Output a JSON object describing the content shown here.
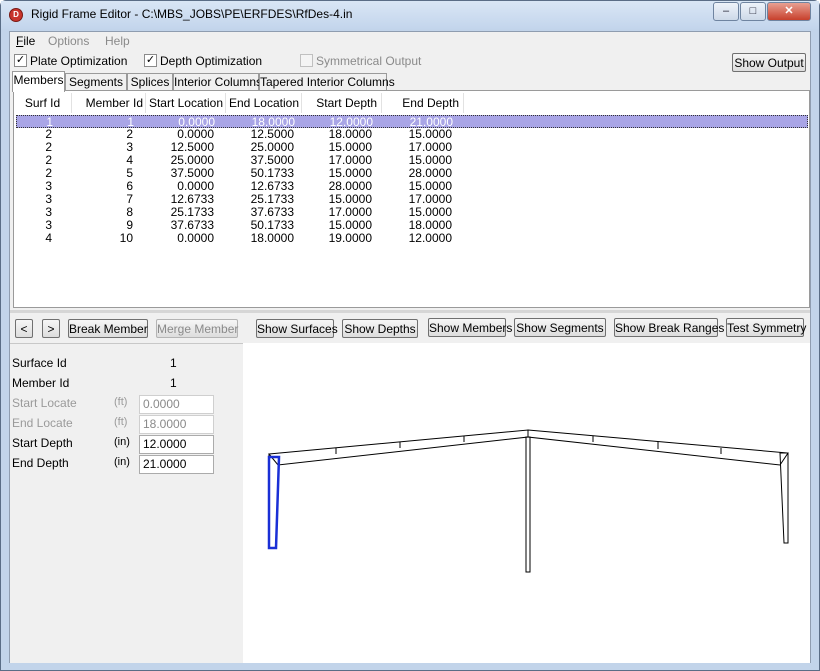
{
  "window": {
    "title": "Rigid Frame Editor - C:\\MBS_JOBS\\PE\\ERFDES\\RfDes-4.in",
    "icon": "app-logo-icon",
    "controls": [
      "minimize",
      "maximize",
      "close"
    ]
  },
  "menu": {
    "file": "File",
    "options": "Options",
    "help": "Help"
  },
  "toolbar": {
    "plate_optimization": {
      "label": "Plate Optimization",
      "checked": true
    },
    "depth_optimization": {
      "label": "Depth Optimization",
      "checked": true
    },
    "symmetrical_output": {
      "label": "Symmetrical Output",
      "checked": false
    },
    "show_output": "Show Output"
  },
  "tabs": [
    {
      "label": "Members",
      "active": true
    },
    {
      "label": "Segments",
      "active": false
    },
    {
      "label": "Splices",
      "active": false
    },
    {
      "label": "Interior Columns",
      "active": false
    },
    {
      "label": "Tapered Interior Columns",
      "active": false
    }
  ],
  "table": {
    "columns": [
      "Surf Id",
      "Member Id",
      "Start Location",
      "End Location",
      "Start Depth",
      "End Depth"
    ],
    "rows": [
      [
        "1",
        "1",
        "0.0000",
        "18.0000",
        "12.0000",
        "21.0000"
      ],
      [
        "2",
        "2",
        "0.0000",
        "12.5000",
        "18.0000",
        "15.0000"
      ],
      [
        "2",
        "3",
        "12.5000",
        "25.0000",
        "15.0000",
        "17.0000"
      ],
      [
        "2",
        "4",
        "25.0000",
        "37.5000",
        "17.0000",
        "15.0000"
      ],
      [
        "2",
        "5",
        "37.5000",
        "50.1733",
        "15.0000",
        "28.0000"
      ],
      [
        "3",
        "6",
        "0.0000",
        "12.6733",
        "28.0000",
        "15.0000"
      ],
      [
        "3",
        "7",
        "12.6733",
        "25.1733",
        "15.0000",
        "17.0000"
      ],
      [
        "3",
        "8",
        "25.1733",
        "37.6733",
        "17.0000",
        "15.0000"
      ],
      [
        "3",
        "9",
        "37.6733",
        "50.1733",
        "15.0000",
        "18.0000"
      ],
      [
        "4",
        "10",
        "0.0000",
        "18.0000",
        "19.0000",
        "12.0000"
      ]
    ],
    "selected_row": 0
  },
  "nav": {
    "prev": "<",
    "next": ">",
    "break_member": "Break Member",
    "merge_member": "Merge Member"
  },
  "properties": {
    "surface_id": {
      "label": "Surface Id",
      "value": "1"
    },
    "member_id": {
      "label": "Member Id",
      "value": "1"
    },
    "start_locate": {
      "label": "Start Locate",
      "unit": "(ft)",
      "value": "0.0000"
    },
    "end_locate": {
      "label": "End Locate",
      "unit": "(ft)",
      "value": "18.0000"
    },
    "start_depth": {
      "label": "Start Depth",
      "unit": "(in)",
      "value": "12.0000"
    },
    "end_depth": {
      "label": "End Depth",
      "unit": "(in)",
      "value": "21.0000"
    }
  },
  "view_buttons": {
    "show_surfaces": "Show Surfaces",
    "show_depths": "Show Depths",
    "show_members": "Show Members",
    "show_segments": "Show Segments",
    "show_break_ranges": "Show Break Ranges",
    "test_symmetry": "Test Symmetry"
  },
  "colors": {
    "selection": "#a9a5e6",
    "highlight_member": "#1a2fd6",
    "frame_line": "#000000"
  }
}
